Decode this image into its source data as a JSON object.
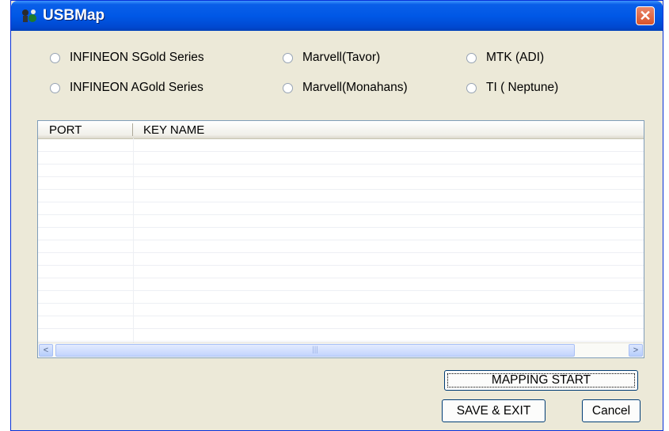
{
  "window": {
    "title": "USBMap",
    "close_glyph": "✕"
  },
  "chipsets": [
    {
      "label": "INFINEON SGold Series"
    },
    {
      "label": "Marvell(Tavor)"
    },
    {
      "label": "MTK (ADI)"
    },
    {
      "label": "INFINEON AGold Series"
    },
    {
      "label": "Marvell(Monahans)"
    },
    {
      "label": "TI ( Neptune)"
    }
  ],
  "list": {
    "columns": [
      "PORT",
      "KEY NAME"
    ],
    "rows": [],
    "scroll_left": "<",
    "scroll_right": ">",
    "thumb_grip": "|||"
  },
  "buttons": {
    "mapping_start": "MAPPING START",
    "save_exit": "SAVE & EXIT",
    "cancel": "Cancel"
  },
  "colors": {
    "titlebar": "#0058e6",
    "dialog_bg": "#ece9d8",
    "close_button": "#d8532a"
  },
  "icons": {
    "app": "usb-app-icon",
    "close": "close-icon"
  }
}
